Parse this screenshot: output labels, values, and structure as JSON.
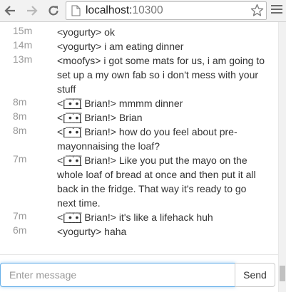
{
  "browser": {
    "url_host": "localhost:",
    "url_port": "10300",
    "icons": {
      "back": "back-arrow-icon",
      "forward": "forward-arrow-icon",
      "reload": "reload-icon",
      "page": "page-icon",
      "bookmark": "star-icon",
      "menu": "menu-icon"
    }
  },
  "chat": {
    "messages": [
      {
        "time": "15m",
        "text": "<yogurty> ok"
      },
      {
        "time": "14m",
        "text": "<yogurty> i am eating dinner"
      },
      {
        "time": "13m",
        "text": "<moofys> i got some mats for us, i am going to set up a my own fab so i don't mess with your stuff"
      },
      {
        "time": "8m",
        "text": "<[ ̲̅•̲̅˙̲̅•̲̅] Brian!> mmmm dinner"
      },
      {
        "time": "8m",
        "text": "<[ ̲̅•̲̅˙̲̅•̲̅] Brian!> Brian"
      },
      {
        "time": "8m",
        "text": "<[ ̲̅•̲̅˙̲̅•̲̅] Brian!> how do you feel about pre-mayonnaising the loaf?"
      },
      {
        "time": "7m",
        "text": "<[ ̲̅•̲̅˙̲̅•̲̅] Brian!> Like you put the mayo on the whole loaf of bread at once and then put it all back in the fridge. That way it's ready to go next time."
      },
      {
        "time": "7m",
        "text": "<[ ̲̅•̲̅˙̲̅•̲̅] Brian!> it's like a lifehack huh"
      },
      {
        "time": "6m",
        "text": "<yogurty> haha"
      }
    ]
  },
  "composer": {
    "placeholder": "Enter message",
    "value": "",
    "send_label": "Send"
  },
  "colors": {
    "focus_border": "#66afe9",
    "timestamp": "#999999",
    "text": "#333333"
  }
}
